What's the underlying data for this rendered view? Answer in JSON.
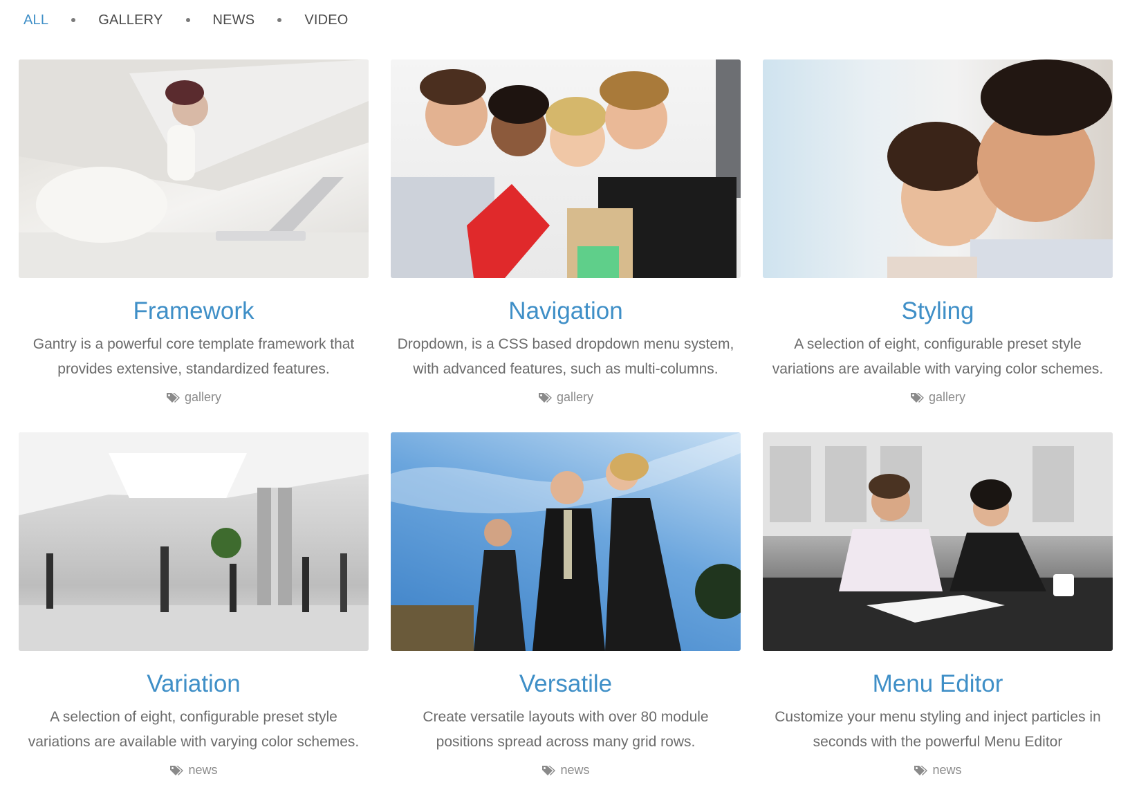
{
  "filters": [
    {
      "label": "ALL",
      "active": true
    },
    {
      "label": "GALLERY",
      "active": false
    },
    {
      "label": "NEWS",
      "active": false
    },
    {
      "label": "VIDEO",
      "active": false
    }
  ],
  "cards": [
    {
      "title": "Framework",
      "description": "Gantry is a powerful core template framework that provides extensive, standardized features.",
      "tag": "gallery",
      "image_alt": "woman-with-laptop-photo"
    },
    {
      "title": "Navigation",
      "description": "Dropdown, is a CSS based dropdown menu system, with advanced features, such as multi-columns.",
      "tag": "gallery",
      "image_alt": "students-group-photo"
    },
    {
      "title": "Styling",
      "description": "A selection of eight, configurable preset style variations are available with varying color schemes.",
      "tag": "gallery",
      "image_alt": "smiling-couple-photo"
    },
    {
      "title": "Variation",
      "description": "A selection of eight, configurable preset style variations are available with varying color schemes.",
      "tag": "news",
      "image_alt": "office-lobby-photo"
    },
    {
      "title": "Versatile",
      "description": "Create versatile layouts with over 80 module positions spread across many grid rows.",
      "tag": "news",
      "image_alt": "business-team-sky-photo"
    },
    {
      "title": "Menu Editor",
      "description": "Customize your menu styling and inject particles in seconds with the powerful Menu Editor",
      "tag": "news",
      "image_alt": "business-meeting-photo"
    }
  ],
  "colors": {
    "accent": "#3f8fc7",
    "text": "#6b6b6b",
    "tag": "#8a8a8a"
  }
}
